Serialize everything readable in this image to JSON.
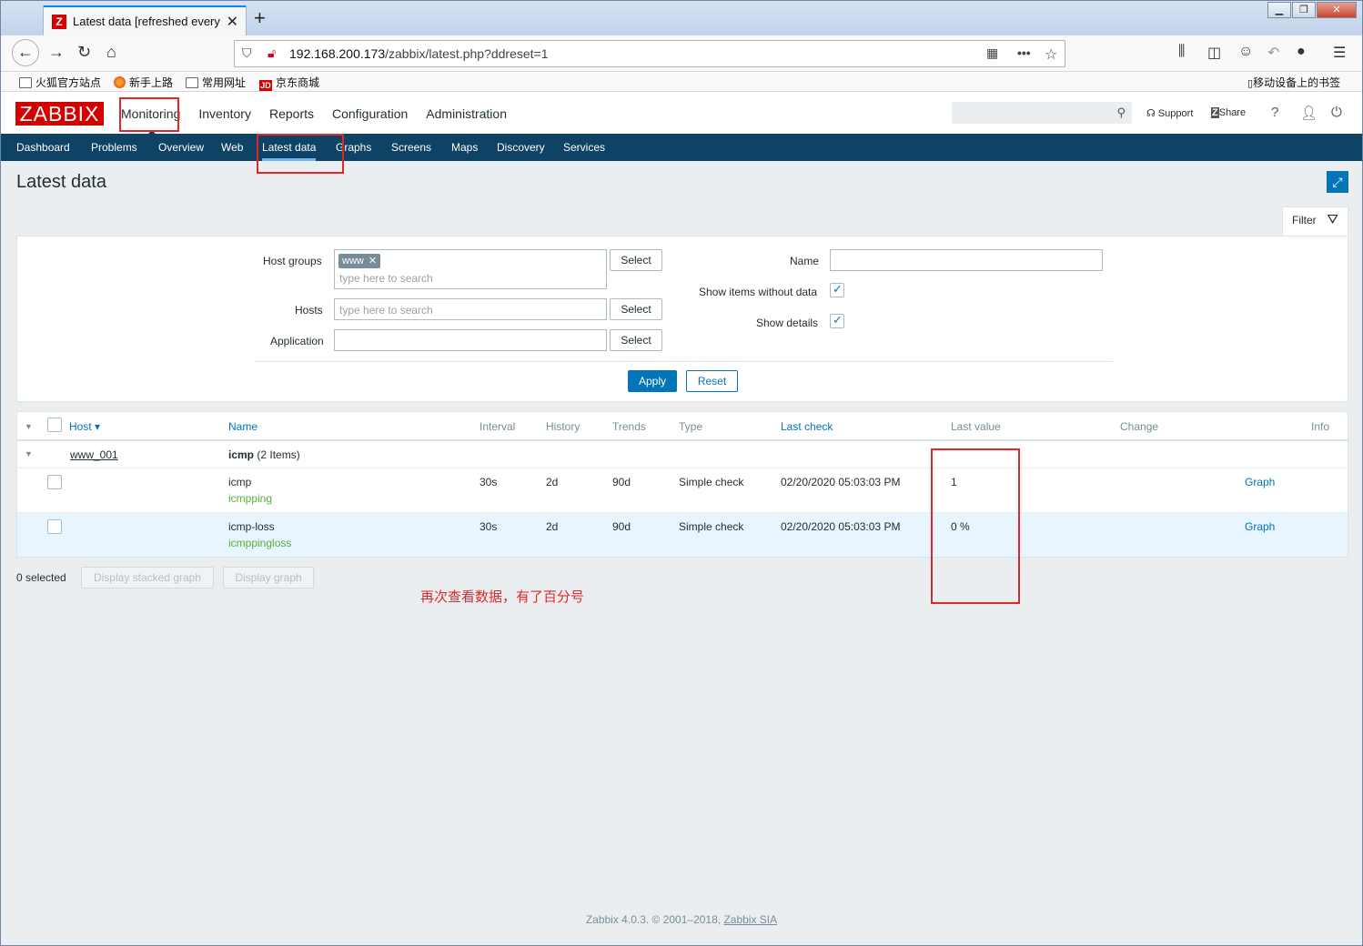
{
  "browser": {
    "tab_title": "Latest data [refreshed every",
    "tab_favicon": "Z",
    "url_host": "192.168.200.173",
    "url_path": "/zabbix/latest.php?ddreset=1"
  },
  "bookmarks": {
    "items": [
      {
        "label": "火狐官方站点",
        "icon": "folder-icon"
      },
      {
        "label": "新手上路",
        "icon": "firefox-icon"
      },
      {
        "label": "常用网址",
        "icon": "folder-icon"
      },
      {
        "label": "京东商城",
        "icon": "jd-icon"
      }
    ],
    "mobile": "移动设备上的书签",
    "jd_badge": "JD"
  },
  "zabbix": {
    "logo": "ZABBIX",
    "top_menu": [
      "Monitoring",
      "Inventory",
      "Reports",
      "Configuration",
      "Administration"
    ],
    "support": "Support",
    "share": "Share",
    "help": "?",
    "sub_menu": [
      "Dashboard",
      "Problems",
      "Overview",
      "Web",
      "Latest data",
      "Graphs",
      "Screens",
      "Maps",
      "Discovery",
      "Services"
    ],
    "active_sub": "Latest data"
  },
  "page": {
    "title": "Latest data",
    "filter_tab": "Filter"
  },
  "filter": {
    "host_groups_label": "Host groups",
    "host_group_chip": "www",
    "search_placeholder": "type here to search",
    "hosts_label": "Hosts",
    "application_label": "Application",
    "select_label": "Select",
    "name_label": "Name",
    "name_value": "",
    "show_items_label": "Show items without data",
    "show_items_checked": true,
    "show_details_label": "Show details",
    "show_details_checked": true,
    "apply_label": "Apply",
    "reset_label": "Reset"
  },
  "table": {
    "headers": {
      "host": "Host ▾",
      "name": "Name",
      "interval": "Interval",
      "history": "History",
      "trends": "Trends",
      "type": "Type",
      "last_check": "Last check",
      "last_value": "Last value",
      "change": "Change",
      "info": "Info"
    },
    "group": {
      "host": "www_001",
      "app": "icmp",
      "count": "(2 Items)"
    },
    "rows": [
      {
        "name": "icmp",
        "key": "icmpping",
        "interval": "30s",
        "history": "2d",
        "trends": "90d",
        "type": "Simple check",
        "last_check": "02/20/2020 05:03:03 PM",
        "last_value": "1",
        "change": "",
        "graph": "Graph"
      },
      {
        "name": "icmp-loss",
        "key": "icmppingloss",
        "interval": "30s",
        "history": "2d",
        "trends": "90d",
        "type": "Simple check",
        "last_check": "02/20/2020 05:03:03 PM",
        "last_value": "0 %",
        "change": "",
        "graph": "Graph"
      }
    ]
  },
  "actions": {
    "selected": "0 selected",
    "stacked": "Display stacked graph",
    "graph": "Display graph"
  },
  "annotation": "再次查看数据，有了百分号",
  "footer": {
    "text": "Zabbix 4.0.3. © 2001–2018, ",
    "link": "Zabbix SIA"
  }
}
